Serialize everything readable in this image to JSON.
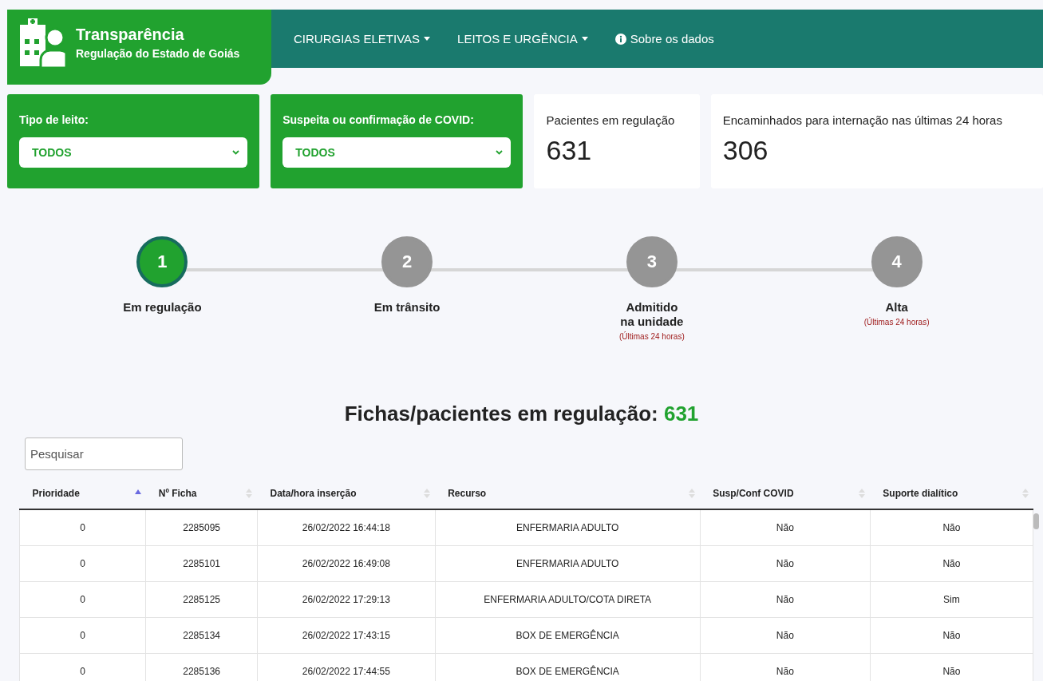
{
  "brand": {
    "title": "Transparência",
    "subtitle": "Regulação do Estado de Goiás"
  },
  "nav": [
    {
      "label": "CIRURGIAS ELETIVAS",
      "kind": "dropdown"
    },
    {
      "label": "LEITOS E URGÊNCIA",
      "kind": "dropdown"
    },
    {
      "label": "Sobre os dados",
      "kind": "info"
    }
  ],
  "filters": [
    {
      "label": "Tipo de leito:",
      "value": "TODOS"
    },
    {
      "label": "Suspeita ou confirmação de COVID:",
      "value": "TODOS"
    }
  ],
  "stats": [
    {
      "label": "Pacientes em regulação",
      "value": "631"
    },
    {
      "label": "Encaminhados para internação nas últimas 24 horas",
      "value": "306"
    }
  ],
  "steps": [
    {
      "number": "1",
      "label": "Em regulação",
      "selected": true
    },
    {
      "number": "2",
      "label": "Em trânsito",
      "selected": false
    },
    {
      "number": "3",
      "label": "Admitido\nna unidade",
      "note": "(Últimas 24 horas)",
      "selected": false
    },
    {
      "number": "4",
      "label": "Alta",
      "note": "(Últimas 24 horas)",
      "selected": false
    }
  ],
  "table_title": {
    "text": "Fichas/pacientes em regulação:",
    "count": "631"
  },
  "search": {
    "placeholder": "Pesquisar"
  },
  "table": {
    "columns": [
      {
        "label": "Prioridade",
        "sorted": true
      },
      {
        "label": "Nº Ficha",
        "sorted": false
      },
      {
        "label": "Data/hora inserção",
        "sorted": false
      },
      {
        "label": "Recurso",
        "sorted": false
      },
      {
        "label": "Susp/Conf COVID",
        "sorted": false
      },
      {
        "label": "Suporte dialítico",
        "sorted": false
      }
    ],
    "rows": [
      [
        "0",
        "2285095",
        "26/02/2022 16:44:18",
        "ENFERMARIA ADULTO",
        "Não",
        "Não"
      ],
      [
        "0",
        "2285101",
        "26/02/2022 16:49:08",
        "ENFERMARIA ADULTO",
        "Não",
        "Não"
      ],
      [
        "0",
        "2285125",
        "26/02/2022 17:29:13",
        "ENFERMARIA ADULTO/COTA DIRETA",
        "Não",
        "Sim"
      ],
      [
        "0",
        "2285134",
        "26/02/2022 17:43:15",
        "BOX DE EMERGÊNCIA",
        "Não",
        "Não"
      ],
      [
        "0",
        "2285136",
        "26/02/2022 17:44:55",
        "BOX DE EMERGÊNCIA",
        "Não",
        "Não"
      ]
    ]
  }
}
